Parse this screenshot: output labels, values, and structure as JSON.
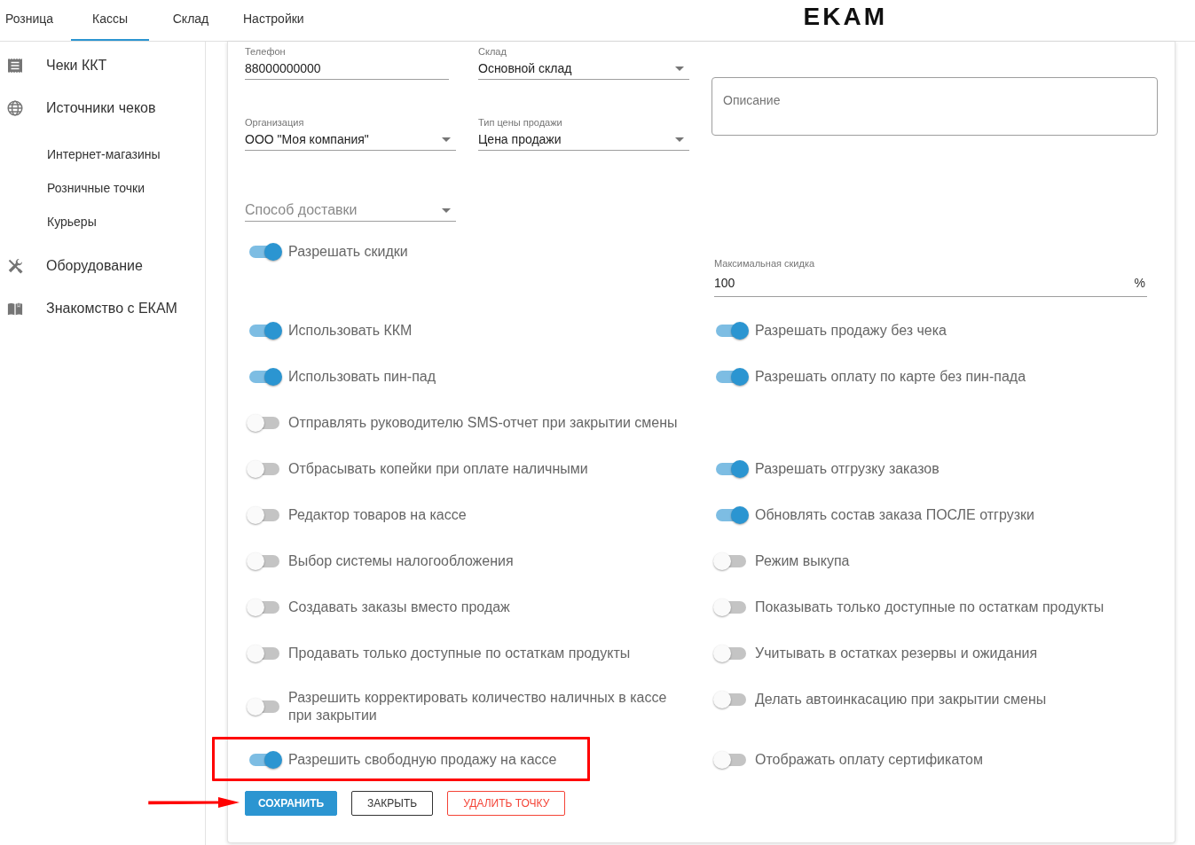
{
  "top_tabs": [
    {
      "label": "Розница",
      "selected": false
    },
    {
      "label": "Кассы",
      "selected": true
    },
    {
      "label": "Склад",
      "selected": false
    },
    {
      "label": "Настройки",
      "selected": false
    }
  ],
  "logo": {
    "text": "EKAM"
  },
  "sidebar": {
    "items": [
      {
        "label": "Чеки ККТ"
      },
      {
        "label": "Источники чеков",
        "children": [
          {
            "label": "Интернет-магазины"
          },
          {
            "label": "Розничные точки"
          },
          {
            "label": "Курьеры"
          }
        ]
      },
      {
        "label": "Оборудование"
      },
      {
        "label": "Знакомство с ЕКАМ"
      }
    ]
  },
  "fields": [
    {
      "kind": "text",
      "label": "Телефон",
      "value": "88000000000"
    },
    {
      "kind": "select",
      "label": "Склад",
      "value": "Основной склад"
    },
    {
      "kind": "select",
      "label": "Организация",
      "value": "ООО \"Моя компания\""
    },
    {
      "kind": "select",
      "label": "Тип цены продажи",
      "value": "Цена продажи"
    },
    {
      "kind": "select",
      "placeholder": "Способ доставки"
    }
  ],
  "description": {
    "placeholder": "Описание"
  },
  "settings": [
    {
      "left": {
        "kind": "toggle",
        "label": "Разрешать скидки",
        "on": true
      },
      "right": {
        "kind": "number_field",
        "label": "Максимальная скидка",
        "value": "100",
        "unit": "%"
      }
    },
    {
      "left": {
        "kind": "toggle",
        "label": "Использовать ККМ",
        "on": true
      },
      "right": {
        "kind": "toggle",
        "label": "Разрешать продажу без чека",
        "on": true
      }
    },
    {
      "left": {
        "kind": "toggle",
        "label": "Использовать пин-пад",
        "on": true
      },
      "right": {
        "kind": "toggle",
        "label": "Разрешать оплату по карте без пин-пада",
        "on": true
      }
    },
    {
      "left": {
        "kind": "toggle",
        "label": "Отправлять руководителю SMS-отчет при закрытии смены",
        "on": false
      }
    },
    {
      "left": {
        "kind": "toggle",
        "label": "Отбрасывать копейки при оплате наличными",
        "on": false
      },
      "right": {
        "kind": "toggle",
        "label": "Разрешать отгрузку заказов",
        "on": true
      }
    },
    {
      "left": {
        "kind": "toggle",
        "label": "Редактор товаров на кассе",
        "on": false
      },
      "right": {
        "kind": "toggle",
        "label": "Обновлять состав заказа ПОСЛЕ отгрузки",
        "on": true
      }
    },
    {
      "left": {
        "kind": "toggle",
        "label": "Выбор системы налогообложения",
        "on": false
      },
      "right": {
        "kind": "toggle",
        "label": "Режим выкупа",
        "on": false
      }
    },
    {
      "left": {
        "kind": "toggle",
        "label": "Создавать заказы вместо продаж",
        "on": false
      },
      "right": {
        "kind": "toggle",
        "label": "Показывать только доступные по остаткам продукты",
        "on": false
      }
    },
    {
      "left": {
        "kind": "toggle",
        "label": "Продавать только доступные по остаткам продукты",
        "on": false
      },
      "right": {
        "kind": "toggle",
        "label": "Учитывать в остатках резервы и ожидания",
        "on": false
      }
    },
    {
      "left": {
        "kind": "toggle",
        "label": "Разрешить корректировать количество наличных в кассе при закрытии",
        "on": false
      },
      "right": {
        "kind": "toggle",
        "label": "Делать автоинкасацию при закрытии смены",
        "on": false
      }
    },
    {
      "left": {
        "kind": "toggle",
        "label": "Разрешить свободную продажу на кассе",
        "on": true,
        "highlighted": true
      },
      "right": {
        "kind": "toggle",
        "label": "Отображать оплату сертификатом",
        "on": false
      }
    }
  ],
  "buttons": [
    {
      "kind": "primary",
      "label": "СОХРАНИТЬ",
      "pointed_at": true
    },
    {
      "kind": "outline",
      "label": "ЗАКРЫТЬ"
    },
    {
      "kind": "danger",
      "label": "УДАЛИТЬ ТОЧКУ"
    }
  ]
}
